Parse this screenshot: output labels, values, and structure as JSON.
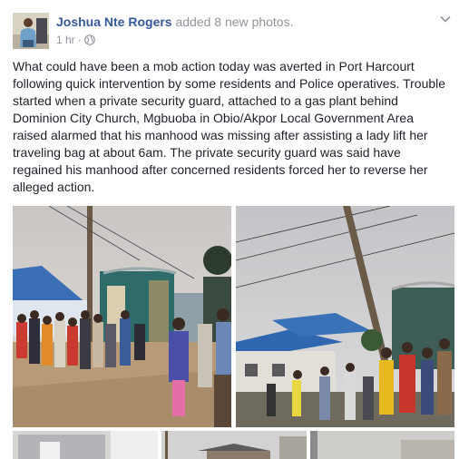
{
  "post": {
    "author_name": "Joshua Nte Rogers",
    "action": "added 8 new photos.",
    "timestamp": "1 hr",
    "separator": "·",
    "audience_icon": "globe-icon",
    "menu_icon": "chevron-down-icon",
    "text": "What could have been a mob action today was averted in Port Harcourt following quick intervention by some residents and Police operatives. Trouble started when a private security guard, attached to a gas plant behind Dominion City Church, Mgbuoba in Obio/Akpor Local Government Area raised alarmed that his manhood was missing after assisting a lady lift her traveling bag at about 6am. The private security guard was said have regained his manhood after concerned residents forced her to reverse her alleged action."
  },
  "colors": {
    "name": "#365899",
    "meta": "#90949c",
    "text": "#1d2129"
  }
}
